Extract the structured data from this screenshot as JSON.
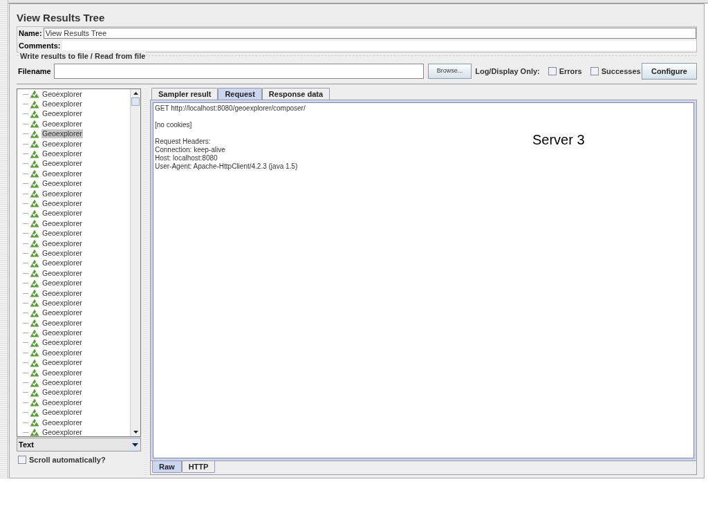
{
  "title": "View Results Tree",
  "name_field": {
    "label": "Name:",
    "value": "View Results Tree"
  },
  "comments_field": {
    "label": "Comments:"
  },
  "file_group": {
    "title": "Write results to file / Read from file",
    "filename_label": "Filename",
    "browse_button": "Browse...",
    "log_label": "Log/Display Only:",
    "checkboxes": [
      {
        "label": "Errors",
        "checked": false
      },
      {
        "label": "Successes",
        "checked": false
      }
    ],
    "configure_button": "Configure"
  },
  "tree": [
    {
      "label": "Geoexplorer",
      "selected": false
    },
    {
      "label": "Geoexplorer",
      "selected": false
    },
    {
      "label": "Geoexplorer",
      "selected": false
    },
    {
      "label": "Geoexplorer",
      "selected": false
    },
    {
      "label": "Geoexplorer",
      "selected": true
    },
    {
      "label": "Geoexplorer",
      "selected": false
    },
    {
      "label": "Geoexplorer",
      "selected": false
    },
    {
      "label": "Geoexplorer",
      "selected": false
    },
    {
      "label": "Geoexplorer",
      "selected": false
    },
    {
      "label": "Geoexplorer",
      "selected": false
    },
    {
      "label": "Geoexplorer",
      "selected": false
    },
    {
      "label": "Geoexplorer",
      "selected": false
    },
    {
      "label": "Geoexplorer",
      "selected": false
    },
    {
      "label": "Geoexplorer",
      "selected": false
    },
    {
      "label": "Geoexplorer",
      "selected": false
    },
    {
      "label": "Geoexplorer",
      "selected": false
    },
    {
      "label": "Geoexplorer",
      "selected": false
    },
    {
      "label": "Geoexplorer",
      "selected": false
    },
    {
      "label": "Geoexplorer",
      "selected": false
    },
    {
      "label": "Geoexplorer",
      "selected": false
    },
    {
      "label": "Geoexplorer",
      "selected": false
    },
    {
      "label": "Geoexplorer",
      "selected": false
    },
    {
      "label": "Geoexplorer",
      "selected": false
    },
    {
      "label": "Geoexplorer",
      "selected": false
    },
    {
      "label": "Geoexplorer",
      "selected": false
    },
    {
      "label": "Geoexplorer",
      "selected": false
    },
    {
      "label": "Geoexplorer",
      "selected": false
    },
    {
      "label": "Geoexplorer",
      "selected": false
    },
    {
      "label": "Geoexplorer",
      "selected": false
    },
    {
      "label": "Geoexplorer",
      "selected": false
    },
    {
      "label": "Geoexplorer",
      "selected": false
    },
    {
      "label": "Geoexplorer",
      "selected": false
    },
    {
      "label": "Geoexplorer",
      "selected": false
    },
    {
      "label": "Geoexplorer",
      "selected": false
    },
    {
      "label": "Geoexplorer",
      "selected": false
    }
  ],
  "renderer_select": {
    "value": "Text"
  },
  "scroll_checkbox": {
    "label": "Scroll automatically?",
    "checked": false
  },
  "tabs": [
    {
      "label": "Sampler result",
      "selected": false
    },
    {
      "label": "Request",
      "selected": true
    },
    {
      "label": "Response data",
      "selected": false
    }
  ],
  "request_text": [
    [
      "GET http://localhost:8080/geoexplorer/composer/"
    ],
    [
      "[no cookies]"
    ],
    [
      "Request Headers:",
      "Connection: keep-alive",
      "Host: localhost:8080",
      "User-Agent: Apache-HttpClient/4.2.3 (java 1.5)"
    ]
  ],
  "annotation": "Server 3",
  "bottom_tabs": [
    {
      "label": "Raw",
      "selected": true
    },
    {
      "label": "HTTP",
      "selected": false
    }
  ]
}
